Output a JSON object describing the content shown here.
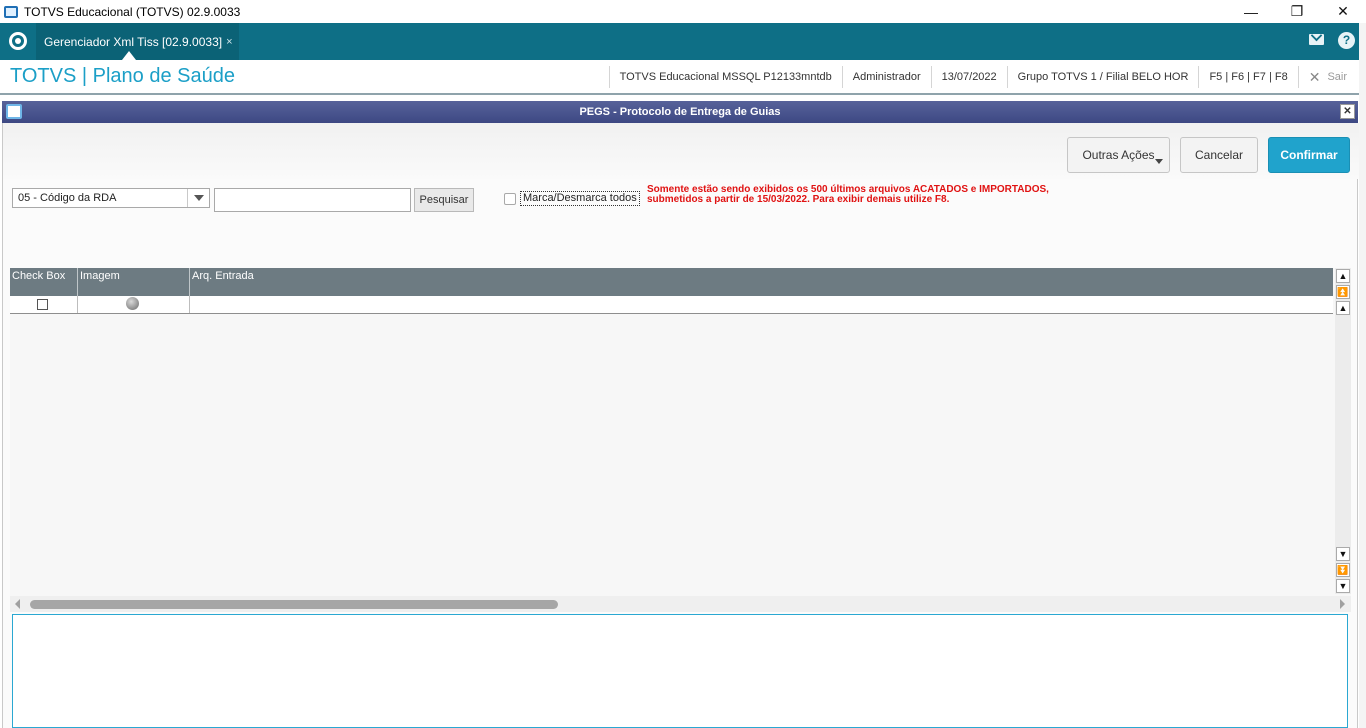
{
  "window": {
    "title": "TOTVS Educacional (TOTVS) 02.9.0033",
    "minimize": "—",
    "restore": "❐",
    "close": "✕"
  },
  "tabbar": {
    "active_tab": "Gerenciador Xml Tiss [02.9.0033]",
    "tab_close": "×",
    "help": "?"
  },
  "header": {
    "brand": "TOTVS | Plano de Saúde",
    "environment": "TOTVS Educacional MSSQL P12133mntdb",
    "user": "Administrador",
    "date": "13/07/2022",
    "branch": "Grupo TOTVS 1 / Filial BELO HOR",
    "shortcuts": "F5 | F6 | F7 | F8",
    "exit_icon": "✕",
    "exit": "Sair"
  },
  "dialog": {
    "title": "PEGS - Protocolo de Entrega de Guias",
    "close": "✕",
    "buttons": {
      "other_actions": "Outras Ações",
      "cancel": "Cancelar",
      "confirm": "Confirmar"
    },
    "filter": {
      "selected_option": "05 - Código da RDA",
      "search_value": "",
      "search_button": "Pesquisar",
      "toggle_all_label": "Marca/Desmarca todos",
      "toggle_all_checked": false
    },
    "notice_line1": "Somente estão sendo exibidos os 500 últimos arquivos ACATADOS e IMPORTADOS,",
    "notice_line2": "submetidos a partir de 15/03/2022. Para exibir demais utilize F8.",
    "notice_color": "#e01212",
    "grid": {
      "columns": [
        "Check Box",
        "Imagem",
        "Arq. Entrada"
      ],
      "rows": [
        {
          "checked": false,
          "status_icon": "gray-status-dot-icon",
          "arq_entrada": ""
        }
      ]
    }
  },
  "colors": {
    "tabbar": "#0e6f86",
    "brand": "#1b9fc7",
    "dialog_title": "#3d4883",
    "confirm": "#20a3cc",
    "grid_header": "#6d7b82"
  }
}
